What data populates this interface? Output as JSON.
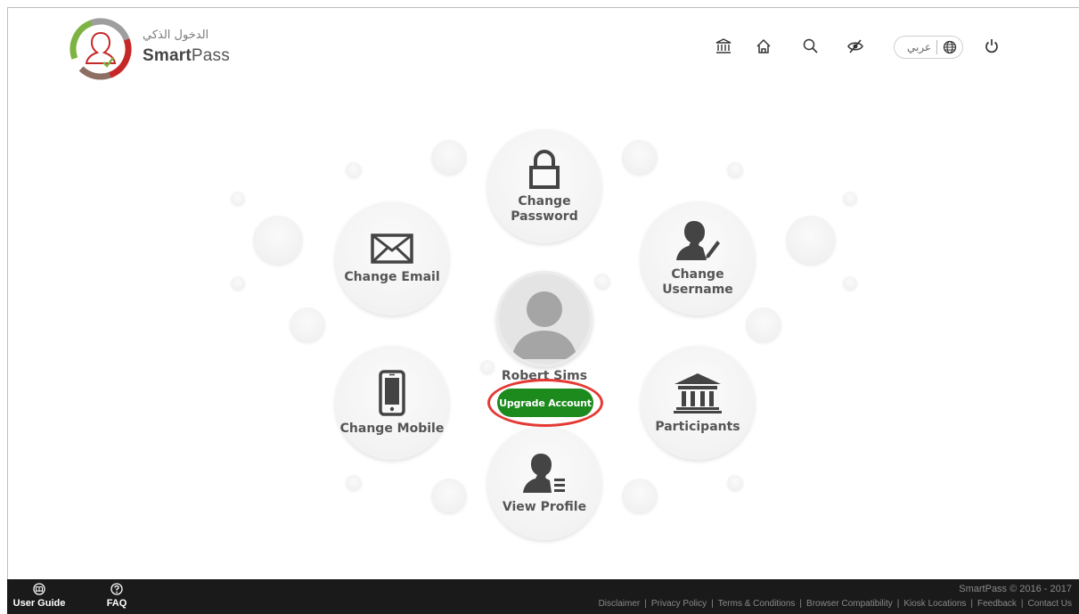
{
  "brand": {
    "arabic": "الدخول الذكي",
    "name_bold": "Smart",
    "name_rest": "Pass"
  },
  "nav": {
    "icons": [
      "government-icon",
      "home-icon",
      "search-icon",
      "accessibility-eye-icon",
      "globe-icon",
      "power-icon"
    ],
    "language_label": "عربي"
  },
  "menu": {
    "change_password": [
      "Change",
      "Password"
    ],
    "change_email": "Change Email",
    "change_username": [
      "Change",
      "Username"
    ],
    "change_mobile": "Change Mobile",
    "participants": "Participants",
    "view_profile": "View Profile"
  },
  "user": {
    "name": "Robert Sims",
    "upgrade_label": "Upgrade Account"
  },
  "footer": {
    "user_guide": "User Guide",
    "faq": "FAQ",
    "copyright": "SmartPass © 2016 - 2017",
    "links": [
      "Disclaimer",
      "Privacy Policy",
      "Terms & Conditions",
      "Browser Compatibility",
      "Kiosk Locations",
      "Feedback",
      "Contact Us"
    ]
  },
  "colors": {
    "upgrade_green": "#1d8a1d",
    "highlight_red": "#e53935",
    "footer_bg": "#1a1a1a"
  }
}
